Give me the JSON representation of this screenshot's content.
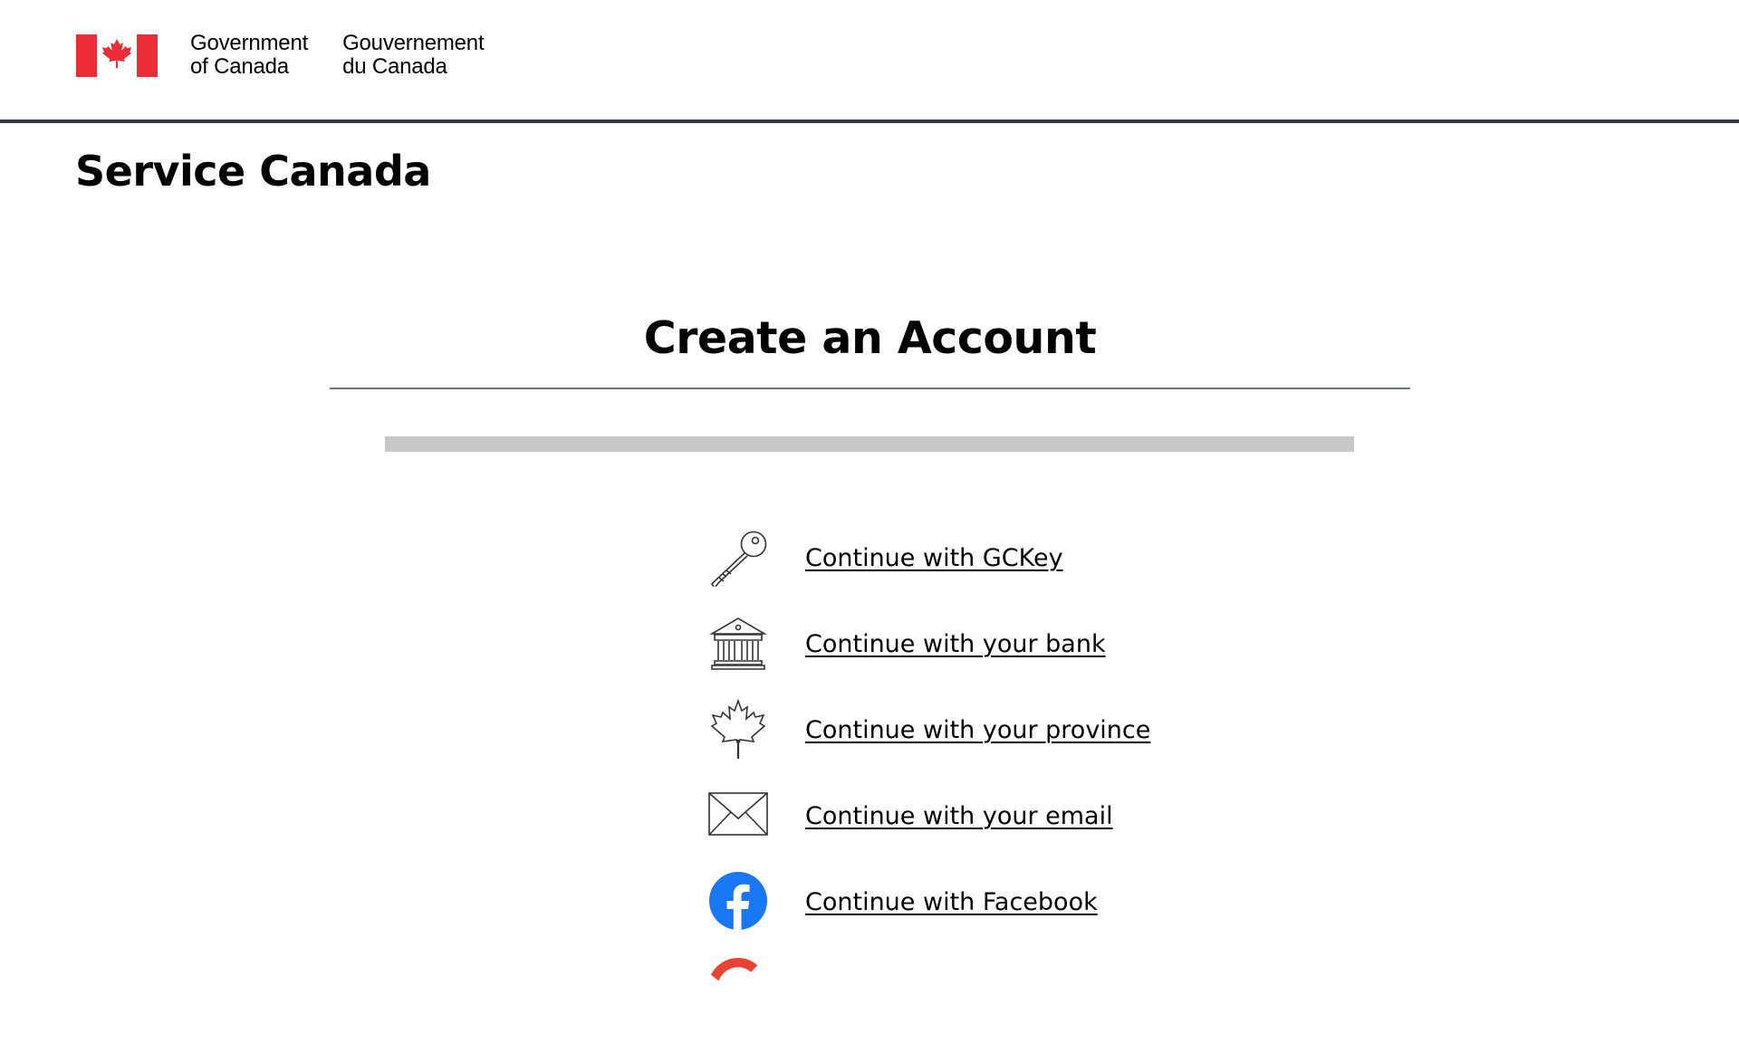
{
  "header": {
    "gov_en": [
      "Government",
      "of Canada"
    ],
    "gov_fr": [
      "Gouvernement",
      "du Canada"
    ],
    "flag_colors": {
      "red": "#eb2d37",
      "white": "#ffffff"
    }
  },
  "site_title": "Service Canada",
  "page_heading": "Create an Account",
  "progress": {
    "value_percent": 100,
    "color": "#c8c8c8"
  },
  "options": [
    {
      "label": "Continue with GCKey",
      "icon": "key-icon"
    },
    {
      "label": "Continue with your bank",
      "icon": "bank-icon"
    },
    {
      "label": "Continue with your province",
      "icon": "maple-leaf-icon"
    },
    {
      "label": "Continue with your email",
      "icon": "envelope-icon"
    },
    {
      "label": "Continue with Facebook",
      "icon": "facebook-icon"
    },
    {
      "label": "",
      "icon": "google-icon"
    }
  ],
  "colors": {
    "header_rule": "#333b47",
    "heading_rule": "#6b7788",
    "facebook_blue": "#1877f2",
    "google_red": "#ea4335"
  }
}
